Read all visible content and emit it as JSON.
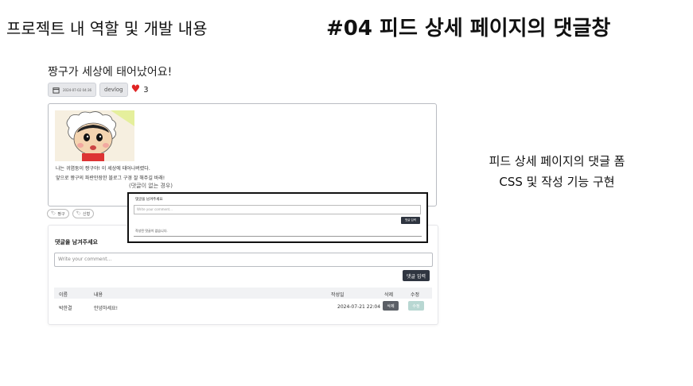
{
  "slide": {
    "left_title": "프로젝트 내 역할 및 개발 내용",
    "right_title": "#04 피드 상세 페이지의 댓글창",
    "desc_line1": "피드 상세 페이지의 댓글 폼",
    "desc_line2": "CSS 및 작성 기능 구현"
  },
  "post": {
    "title": "짱구가 세상에 태어났어요!",
    "date": "2024-07-02 04:36",
    "category": "devlog",
    "likes": "3",
    "line1": "나는 귀염둥이 짱구야! 이 세상에 태어나버렸다.",
    "line2": "앞으로 짱구의 파란만장한 블로그 구경 잘 해주길 바래!",
    "tags": [
      "짱구",
      "신형"
    ]
  },
  "comments": {
    "title": "댓글을 남겨주세요",
    "placeholder": "Write your comment...",
    "submit": "댓글 입력",
    "headers": {
      "name": "이름",
      "content": "내용",
      "date": "작성일",
      "delete": "삭제",
      "edit": "수정"
    },
    "rows": [
      {
        "name": "박한결",
        "content": "안녕하세요!",
        "date": "2024-07-21 22:04",
        "delete": "삭제",
        "edit": "수정"
      }
    ]
  },
  "empty_case": {
    "label": "(댓글이 없는 경우)",
    "title": "댓글을 남겨주세요",
    "placeholder": "Write your comment...",
    "submit": "댓글 입력",
    "empty_text": "작성된 댓글이 없습니다."
  }
}
